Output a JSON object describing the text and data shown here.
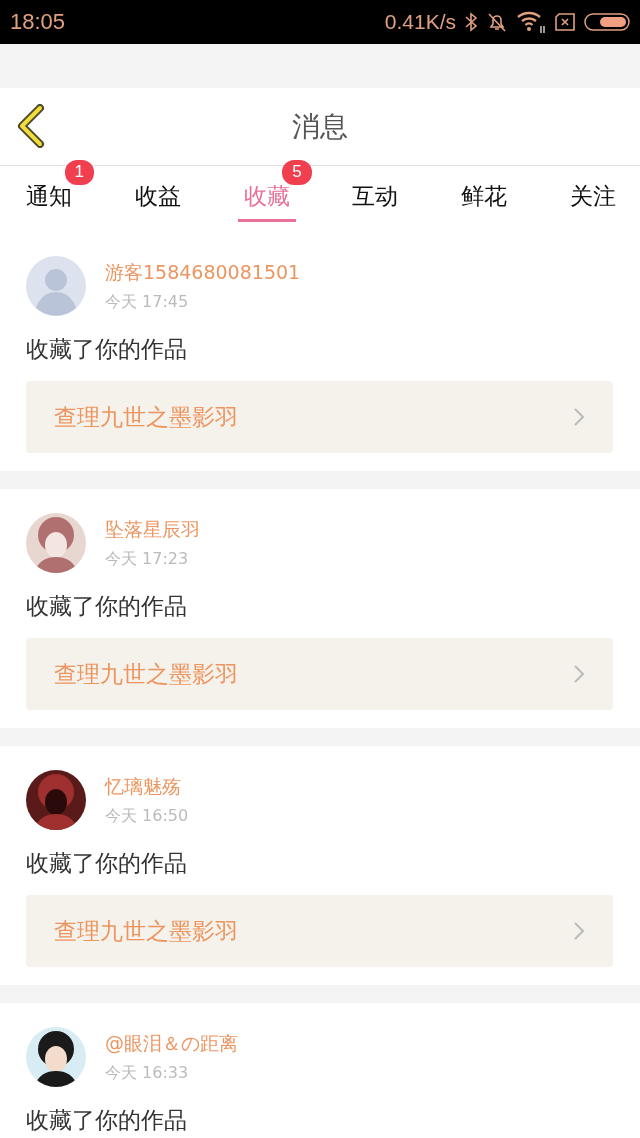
{
  "status_bar": {
    "time": "18:05",
    "speed": "0.41K/s"
  },
  "header": {
    "title": "消息"
  },
  "tabs": [
    {
      "label": "通知",
      "selected": false,
      "badge": "1"
    },
    {
      "label": "收益",
      "selected": false
    },
    {
      "label": "收藏",
      "selected": true,
      "badge": "5"
    },
    {
      "label": "互动",
      "selected": false
    },
    {
      "label": "鲜花",
      "selected": false
    },
    {
      "label": "关注",
      "selected": false
    }
  ],
  "messages": [
    {
      "avatar": {
        "kind": "placeholder"
      },
      "name": "游客1584680081501",
      "time": "今天 17:45",
      "text": "收藏了你的作品",
      "work": "查理九世之墨影羽"
    },
    {
      "name": "坠落星辰羽",
      "time": "今天 17:23",
      "text": "收藏了你的作品",
      "work": "查理九世之墨影羽"
    },
    {
      "name": "忆璃魅殇",
      "time": "今天 16:50",
      "text": "收藏了你的作品",
      "work": "查理九世之墨影羽"
    },
    {
      "name": "@眼泪＆の距离",
      "time": "今天 16:33",
      "text": "收藏了你的作品"
    }
  ]
}
